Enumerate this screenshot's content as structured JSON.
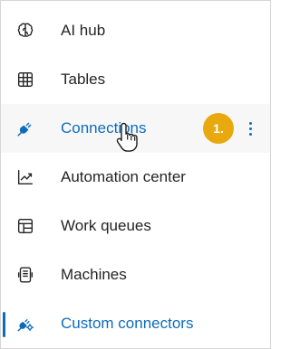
{
  "nav": {
    "items": [
      {
        "label": "AI hub",
        "icon": "brain-icon"
      },
      {
        "label": "Tables",
        "icon": "table-icon"
      },
      {
        "label": "Connections",
        "icon": "plug-icon"
      },
      {
        "label": "Automation center",
        "icon": "chart-line-icon"
      },
      {
        "label": "Work queues",
        "icon": "work-queue-icon"
      },
      {
        "label": "Machines",
        "icon": "machine-icon"
      },
      {
        "label": "Custom connectors",
        "icon": "custom-connector-icon"
      }
    ],
    "hovered_item": "Connections",
    "selected_item": "Custom connectors"
  },
  "callout": {
    "step": "1."
  },
  "colors": {
    "accent": "#0f6cbd",
    "badge": "#e8a80e",
    "text": "#242424"
  }
}
